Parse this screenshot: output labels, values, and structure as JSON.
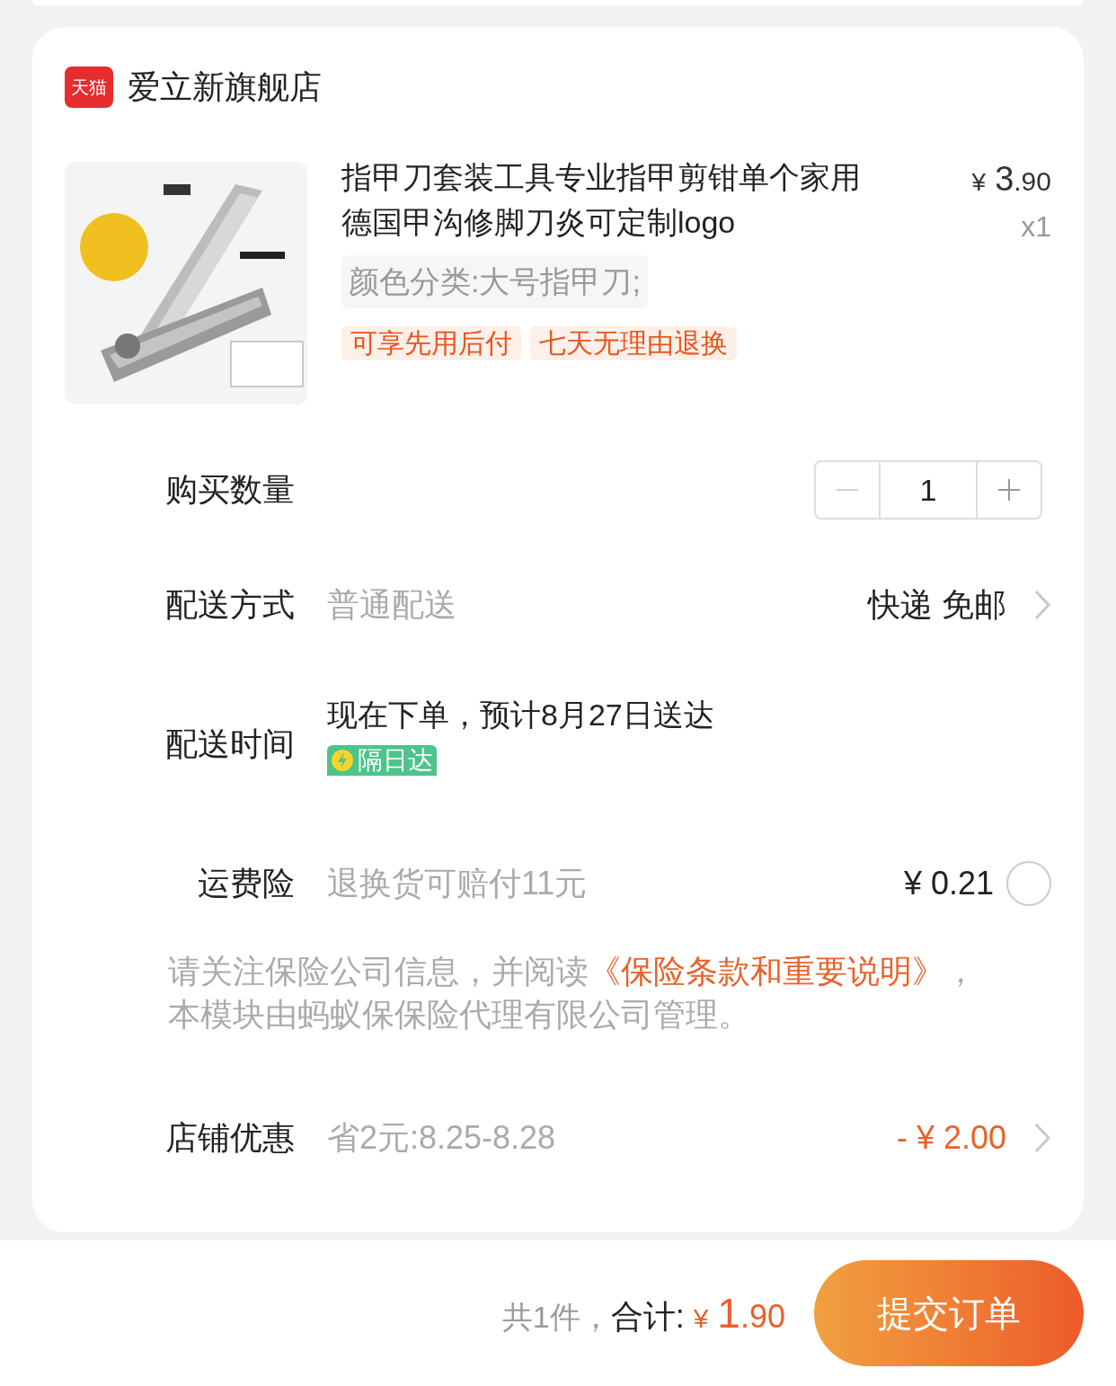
{
  "shop": {
    "badge": "天猫",
    "name": "爱立新旗舰店"
  },
  "product": {
    "title": "指甲刀套装工具专业指甲剪钳单个家用德国甲沟修脚刀炎可定制logo",
    "currency": "¥",
    "price_int": "3",
    "price_dec": ".90",
    "quantity": "x1",
    "spec": "颜色分类:大号指甲刀;",
    "tags": [
      "可享先用后付",
      "七天无理由退换"
    ]
  },
  "rows": [
    {
      "kind": "stepper",
      "label": "购买数量",
      "value": "1",
      "minus_disabled": true,
      "plus_disabled": false
    },
    {
      "kind": "link",
      "label": "配送方式",
      "value": "普通配送",
      "detail": "快递 免邮"
    },
    {
      "kind": "eta",
      "label": "配送时间",
      "value": "现在下单，预计8月27日送达",
      "badge": "隔日达"
    },
    {
      "kind": "toggle",
      "label": "运费险",
      "value": "退换货可赔付11元",
      "detail": "¥ 0.21",
      "checked": false
    },
    {
      "kind": "notice",
      "before": "请关注保险公司信息，并阅读",
      "link": "《保险条款和重要说明》",
      "after": "，本模块由蚂蚁保保险代理有限公司管理。"
    },
    {
      "kind": "discount",
      "label": "店铺优惠",
      "value": "省2元:8.25-8.28",
      "detail": "- ¥ 2.00"
    }
  ],
  "footer": {
    "count": "共1件，",
    "total_label": "合计:",
    "currency": "¥",
    "total_int": "1",
    "total_dec": ".90",
    "submit": "提交订单"
  }
}
